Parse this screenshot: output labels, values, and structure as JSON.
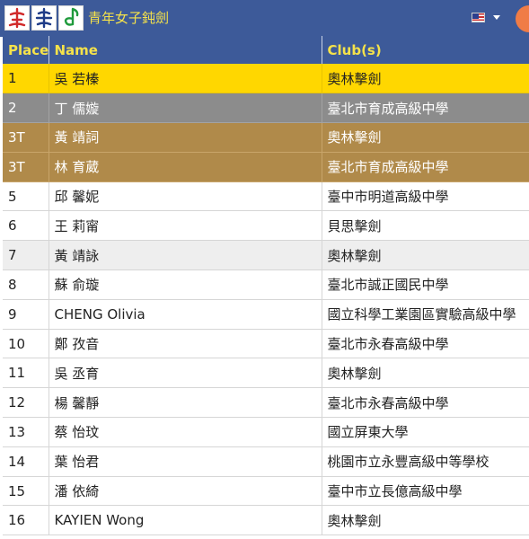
{
  "header": {
    "title": "青年女子鈍劍",
    "logos": [
      {
        "icon": "fencer-logo-red",
        "color": "#d12a2a"
      },
      {
        "icon": "fencer-logo-navy",
        "color": "#1f3c88"
      },
      {
        "icon": "fencer-logo-green",
        "color": "#1f9a3c"
      }
    ],
    "language_flag": "us-flag-icon"
  },
  "table": {
    "columns": {
      "place": "Place",
      "name": "Name",
      "club": "Club(s)"
    },
    "rows": [
      {
        "place": "1",
        "name": "吳 若榛",
        "club": "奧林擊劍"
      },
      {
        "place": "2",
        "name": "丁 儒嫙",
        "club": "臺北市育成高級中學"
      },
      {
        "place": "3T",
        "name": "黃 靖詞",
        "club": "奧林擊劍"
      },
      {
        "place": "3T",
        "name": "林 育葳",
        "club": "臺北市育成高級中學"
      },
      {
        "place": "5",
        "name": "邱 馨妮",
        "club": "臺中市明道高級中學"
      },
      {
        "place": "6",
        "name": "王 莉甯",
        "club": "貝思擊劍"
      },
      {
        "place": "7",
        "name": "黃 靖詠",
        "club": "奧林擊劍"
      },
      {
        "place": "8",
        "name": "蘇 俞璇",
        "club": "臺北市誠正國民中學"
      },
      {
        "place": "9",
        "name": "CHENG Olivia",
        "club": "國立科學工業園區實驗高級中學"
      },
      {
        "place": "10",
        "name": "鄭 孜音",
        "club": "臺北市永春高級中學"
      },
      {
        "place": "11",
        "name": "吳 丞育",
        "club": "奧林擊劍"
      },
      {
        "place": "12",
        "name": "楊 馨靜",
        "club": "臺北市永春高級中學"
      },
      {
        "place": "13",
        "name": "蔡 怡玟",
        "club": "國立屏東大學"
      },
      {
        "place": "14",
        "name": "葉 怡君",
        "club": "桃園市立永豐高級中等學校"
      },
      {
        "place": "15",
        "name": "潘 依綺",
        "club": "臺中市立長億高級中學"
      },
      {
        "place": "16",
        "name": "KAYIEN Wong",
        "club": "奧林擊劍"
      }
    ]
  }
}
